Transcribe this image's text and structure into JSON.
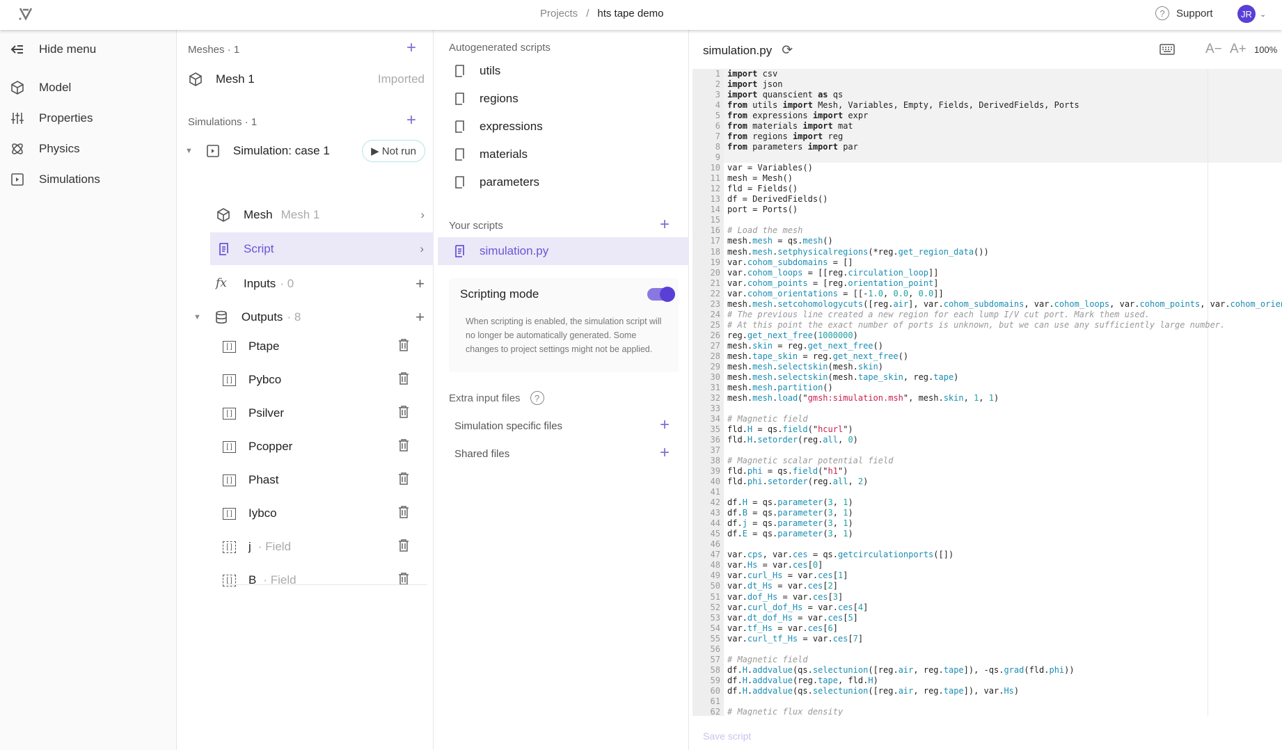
{
  "header": {
    "breadcrumb_root": "Projects",
    "separator": "/",
    "project": "hts tape demo",
    "support": "Support",
    "avatar": "JR"
  },
  "nav": {
    "hide": "Hide menu",
    "items": [
      "Model",
      "Properties",
      "Physics",
      "Simulations"
    ]
  },
  "tree": {
    "meshes_label": "Meshes",
    "meshes_count": "1",
    "mesh1": "Mesh 1",
    "mesh1_status": "Imported",
    "sims_label": "Simulations",
    "sims_count": "1",
    "sim": "Simulation: case 1",
    "sim_status": "Not run",
    "mesh_row": "Mesh",
    "mesh_row_value": "Mesh 1",
    "script_row": "Script",
    "inputs": "Inputs",
    "inputs_count": "0",
    "outputs": "Outputs",
    "outputs_count": "8",
    "outputs_list": [
      {
        "name": "Ptape",
        "type": ""
      },
      {
        "name": "Pybco",
        "type": ""
      },
      {
        "name": "Psilver",
        "type": ""
      },
      {
        "name": "Pcopper",
        "type": ""
      },
      {
        "name": "Phast",
        "type": ""
      },
      {
        "name": "Iybco",
        "type": ""
      },
      {
        "name": "j",
        "type": "Field"
      },
      {
        "name": "B",
        "type": "Field"
      }
    ]
  },
  "scripts": {
    "auto_label": "Autogenerated scripts",
    "auto": [
      "utils",
      "regions",
      "expressions",
      "materials",
      "parameters"
    ],
    "yours_label": "Your scripts",
    "yours": [
      "simulation.py"
    ],
    "mode_label": "Scripting mode",
    "mode_on": true,
    "mode_help": "When scripting is enabled, the simulation script will no longer be automatically generated. Some changes to project settings might not be applied.",
    "extra_label": "Extra input files",
    "specific": "Simulation specific files",
    "shared": "Shared files"
  },
  "editor": {
    "filename": "simulation.py",
    "zoom": "100%",
    "save": "Save script",
    "font_dec": "A−",
    "font_inc": "A+",
    "lines": [
      "import csv",
      "import json",
      "import quanscient as qs",
      "from utils import Mesh, Variables, Empty, Fields, DerivedFields, Ports",
      "from expressions import expr",
      "from materials import mat",
      "from regions import reg",
      "from parameters import par",
      "",
      "var = Variables()",
      "mesh = Mesh()",
      "fld = Fields()",
      "df = DerivedFields()",
      "port = Ports()",
      "",
      "# Load the mesh",
      "mesh.mesh = qs.mesh()",
      "mesh.mesh.setphysicalregions(*reg.get_region_data())",
      "var.cohom_subdomains = []",
      "var.cohom_loops = [[reg.circulation_loop]]",
      "var.cohom_points = [reg.orientation_point]",
      "var.cohom_orientations = [[-1.0, 0.0, 0.0]]",
      "mesh.mesh.setcohomologycuts([reg.air], var.cohom_subdomains, var.cohom_loops, var.cohom_points, var.cohom_orientat",
      "# The previous line created a new region for each lump I/V cut port. Mark them used.",
      "# At this point the exact number of ports is unknown, but we can use any sufficiently large number.",
      "reg.get_next_free(1000000)",
      "mesh.skin = reg.get_next_free()",
      "mesh.tape_skin = reg.get_next_free()",
      "mesh.mesh.selectskin(mesh.skin)",
      "mesh.mesh.selectskin(mesh.tape_skin, reg.tape)",
      "mesh.mesh.partition()",
      "mesh.mesh.load(\"gmsh:simulation.msh\", mesh.skin, 1, 1)",
      "",
      "# Magnetic field",
      "fld.H = qs.field(\"hcurl\")",
      "fld.H.setorder(reg.all, 0)",
      "",
      "# Magnetic scalar potential field",
      "fld.phi = qs.field(\"h1\")",
      "fld.phi.setorder(reg.all, 2)",
      "",
      "df.H = qs.parameter(3, 1)",
      "df.B = qs.parameter(3, 1)",
      "df.j = qs.parameter(3, 1)",
      "df.E = qs.parameter(3, 1)",
      "",
      "var.cps, var.ces = qs.getcirculationports([])",
      "var.Hs = var.ces[0]",
      "var.curl_Hs = var.ces[1]",
      "var.dt_Hs = var.ces[2]",
      "var.dof_Hs = var.ces[3]",
      "var.curl_dof_Hs = var.ces[4]",
      "var.dt_dof_Hs = var.ces[5]",
      "var.tf_Hs = var.ces[6]",
      "var.curl_tf_Hs = var.ces[7]",
      "",
      "# Magnetic field",
      "df.H.addvalue(qs.selectunion([reg.air, reg.tape]), -qs.grad(fld.phi))",
      "df.H.addvalue(reg.tape, fld.H)",
      "df.H.addvalue(qs.selectunion([reg.air, reg.tape]), var.Hs)",
      "",
      "# Magnetic flux density"
    ]
  },
  "colors": {
    "accent": "#6a55d6",
    "selected_bg": "#ebe8f8",
    "avatar": "#5a3fd6"
  }
}
